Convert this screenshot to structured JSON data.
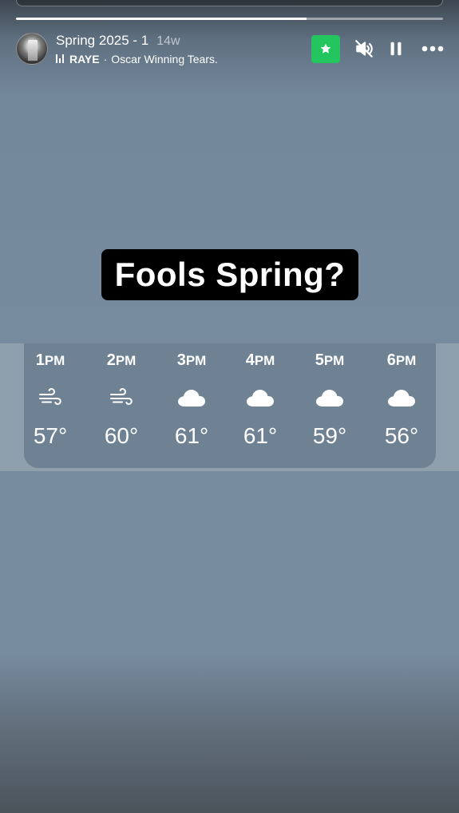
{
  "story": {
    "title": "Spring 2025 - 1",
    "age": "14w",
    "music": {
      "artist": "RAYE",
      "separator": "·",
      "track": "Oscar Winning Tears."
    },
    "progress": {
      "segments": 1,
      "filled_fraction": 0.68
    }
  },
  "controls": {
    "favorite_icon": "star-icon",
    "mute_icon": "muted-speaker-icon",
    "pause_icon": "pause-icon",
    "more_icon": "more-icon",
    "favorite_color": "#22c55e"
  },
  "sticker": {
    "text": "Fools Spring?"
  },
  "forecast": [
    {
      "hour": "1",
      "ampm": "PM",
      "icon": "wind-icon",
      "temp": "57°"
    },
    {
      "hour": "2",
      "ampm": "PM",
      "icon": "wind-icon",
      "temp": "60°"
    },
    {
      "hour": "3",
      "ampm": "PM",
      "icon": "cloud-icon",
      "temp": "61°"
    },
    {
      "hour": "4",
      "ampm": "PM",
      "icon": "cloud-icon",
      "temp": "61°"
    },
    {
      "hour": "5",
      "ampm": "PM",
      "icon": "cloud-icon",
      "temp": "59°"
    },
    {
      "hour": "6",
      "ampm": "PM",
      "icon": "cloud-icon",
      "temp": "56°"
    }
  ]
}
